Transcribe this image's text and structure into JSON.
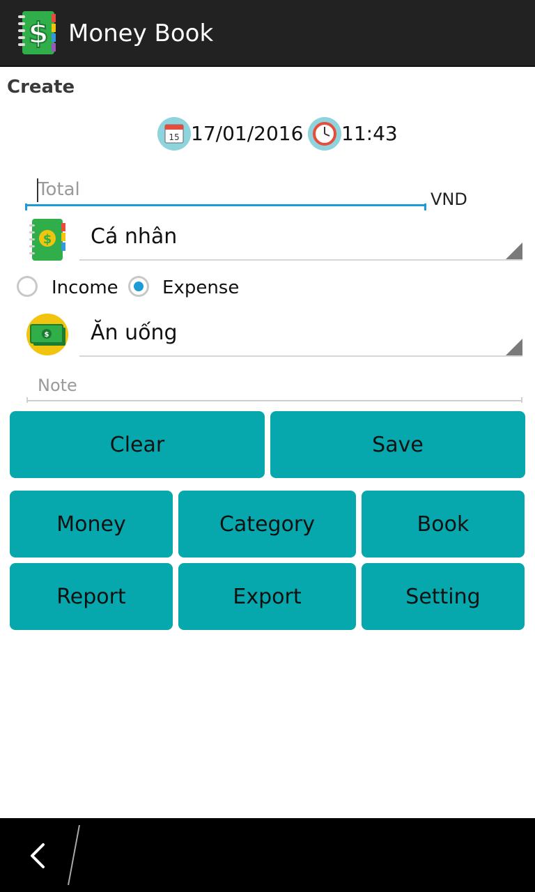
{
  "app": {
    "title": "Money Book",
    "icon": "money-book-icon"
  },
  "form": {
    "section_title": "Create",
    "date": "17/01/2016",
    "time": "11:43",
    "total": {
      "value": "",
      "placeholder": "Total",
      "currency": "VND"
    },
    "book": {
      "selected": "Cá nhân",
      "icon": "book-icon"
    },
    "type": {
      "income_label": "Income",
      "expense_label": "Expense",
      "selected": "Expense"
    },
    "category": {
      "selected": "Ăn uống",
      "icon": "money-bill-icon"
    },
    "note": {
      "value": "",
      "placeholder": "Note"
    }
  },
  "actions": {
    "clear_label": "Clear",
    "save_label": "Save"
  },
  "menu": {
    "money": "Money",
    "category": "Category",
    "book": "Book",
    "report": "Report",
    "export": "Export",
    "setting": "Setting"
  },
  "colors": {
    "accent": "#06a8ad",
    "focus": "#1e9ad6",
    "titlebar": "#222222",
    "navbar": "#000000"
  }
}
